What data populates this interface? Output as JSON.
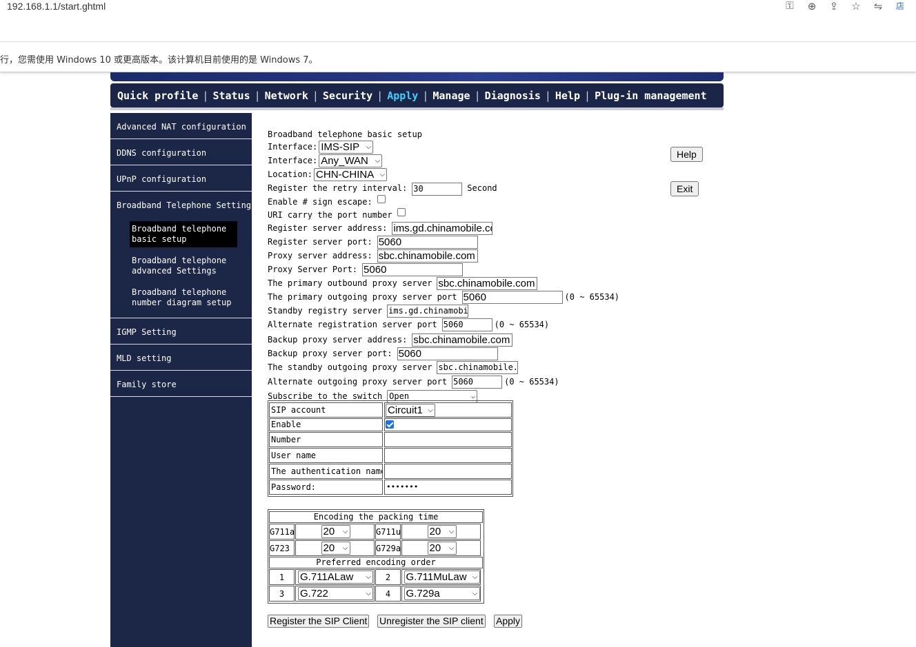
{
  "browser": {
    "url": "192.168.1.1/start.ghtml",
    "infobar_text": "行，您需使用 Windows 10 或更高版本。该计算机目前使用的是 Windows 7。",
    "ext_label": "店"
  },
  "nav": {
    "items": [
      "Quick profile",
      "Status",
      "Network",
      "Security",
      "Apply",
      "Manage",
      "Diagnosis",
      "Help",
      "Plug-in management"
    ],
    "active": "Apply",
    "active_color": "#3fd0ff"
  },
  "sidebar": {
    "items": [
      "Advanced NAT configuration",
      "DDNS configuration",
      "UPnP configuration",
      "Broadband Telephone Settings"
    ],
    "subitems": [
      {
        "line1": "Broadband telephone",
        "line2": "basic setup"
      },
      {
        "line1": "Broadband telephone",
        "line2": "advanced Settings"
      },
      {
        "line1": "Broadband telephone",
        "line2": "number diagram setup"
      }
    ],
    "items_after": [
      "IGMP Setting",
      "MLD setting",
      "Family store"
    ]
  },
  "form": {
    "title": "Broadband telephone basic setup",
    "interface1_label": "Interface:",
    "interface1_value": "IMS-SIP",
    "interface2_label": "Interface:",
    "interface2_value": "Any_WAN",
    "location_label": "Location:",
    "location_value": "CHN-CHINA",
    "retry_label": "Register the retry interval:",
    "retry_value": "30",
    "retry_unit": "Second",
    "sign_escape_label": "Enable # sign escape:",
    "uri_port_label": "URI carry the port number",
    "reg_server_label": "Register server address:",
    "reg_server_value": "ims.gd.chinamobile.com",
    "reg_port_label": "Register server port:",
    "reg_port_value": "5060",
    "proxy_addr_label": "Proxy server address:",
    "proxy_addr_value": "sbc.chinamobile.com",
    "proxy_port_label": "Proxy Server Port:",
    "proxy_port_value": "5060",
    "primary_outbound_label": "The primary outbound proxy server",
    "primary_outbound_value": "sbc.chinamobile.com",
    "primary_outgoing_port_label": "The primary outgoing proxy server port",
    "primary_outgoing_port_value": "5060",
    "range_text": "(0 ~ 65534)",
    "standby_reg_label": "Standby registry server",
    "standby_reg_value": "ims.gd.chinamobile.com",
    "alt_reg_port_label": "Alternate registration server port",
    "alt_reg_port_value": "5060",
    "backup_proxy_addr_label": "Backup proxy server address:",
    "backup_proxy_addr_value": "sbc.chinamobile.com",
    "backup_proxy_port_label": "Backup proxy server port:",
    "backup_proxy_port_value": "5060",
    "standby_outgoing_label": "The standby outgoing proxy server",
    "standby_outgoing_value": "sbc.chinamobile.com",
    "alt_outgoing_port_label": "Alternate outgoing proxy server port",
    "alt_outgoing_port_value": "5060",
    "subscribe_label": "Subscribe to the switch",
    "subscribe_value": "Open"
  },
  "side_buttons": {
    "help": "Help",
    "exit": "Exit"
  },
  "sip": {
    "account_label": "SIP account",
    "account_value": "Circuit1",
    "enable_label": "Enable",
    "number_label": "Number",
    "username_label": "User name",
    "authname_label": "The authentication name",
    "password_label": "Password:",
    "password_mask": "•••••••"
  },
  "codec": {
    "packing_title": "Encoding the packing time",
    "g711a": "G711a",
    "g711a_value": "20",
    "g711u": "G711u",
    "g711u_value": "20",
    "g723": "G723",
    "g723_value": "20",
    "g729a": "G729a",
    "g729a_value": "20",
    "order_title": "Preferred encoding order",
    "order": [
      {
        "n": "1",
        "codec": "G.711ALaw"
      },
      {
        "n": "2",
        "codec": "G.711MuLaw"
      },
      {
        "n": "3",
        "codec": "G.722"
      },
      {
        "n": "4",
        "codec": "G.729a"
      }
    ]
  },
  "buttons": {
    "register": "Register the SIP Client",
    "unregister": "Unregister the SIP client",
    "apply": "Apply"
  }
}
